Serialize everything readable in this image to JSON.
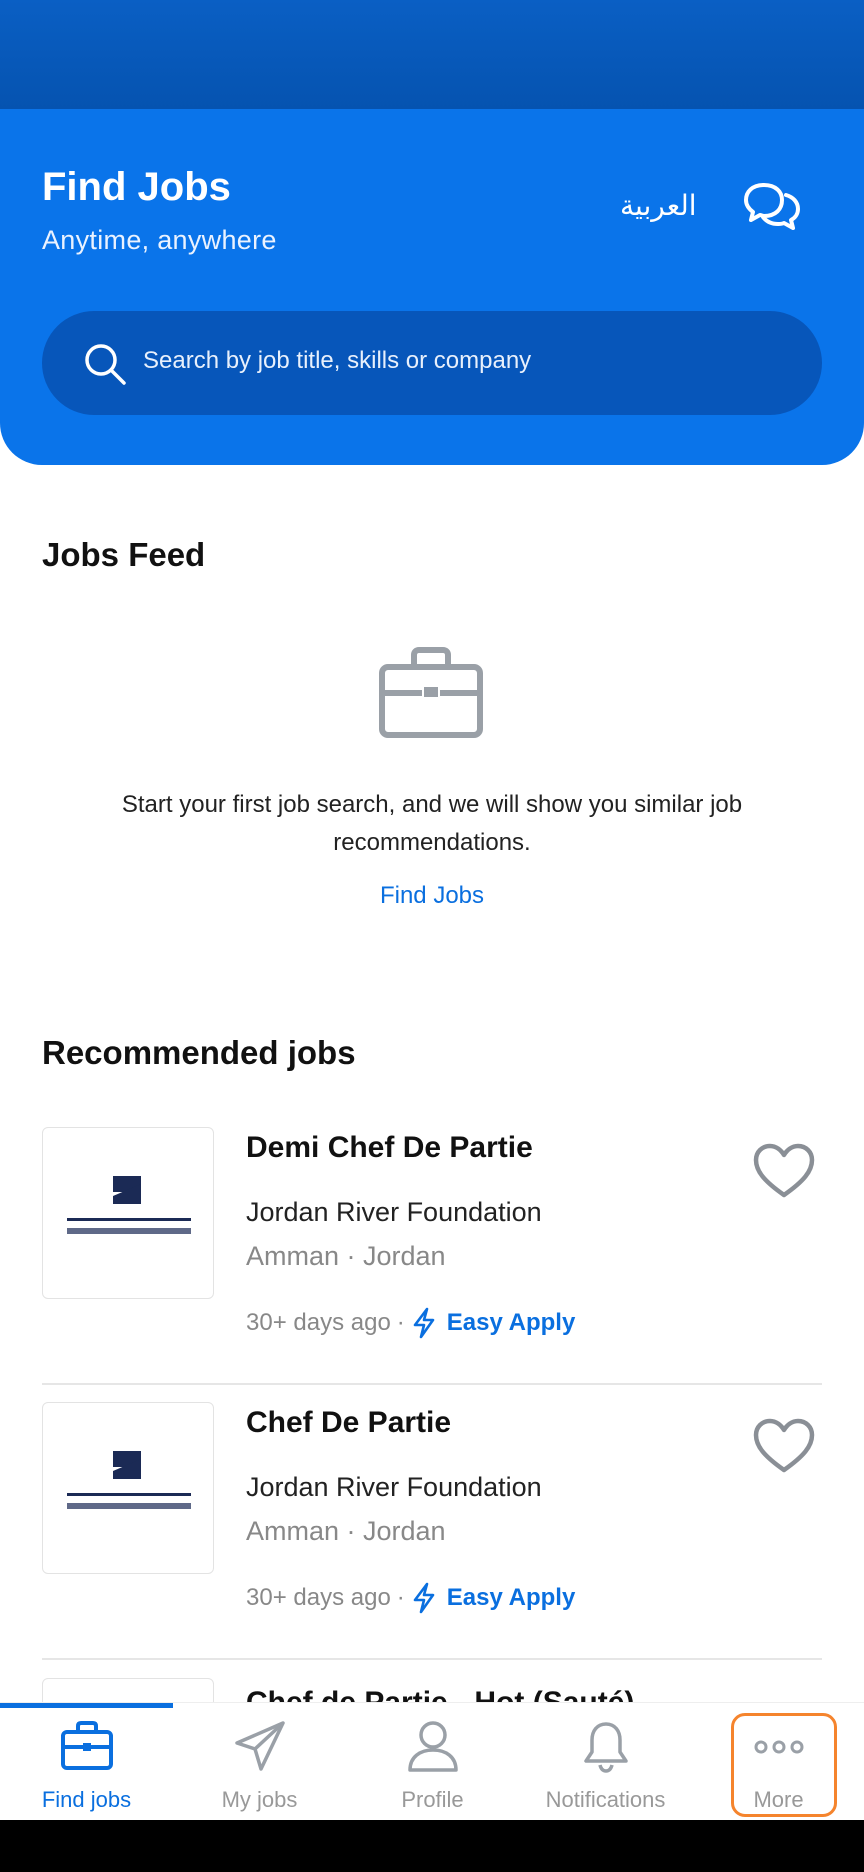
{
  "header": {
    "title": "Find Jobs",
    "subtitle": "Anytime, anywhere",
    "language_label": "العربية",
    "search_placeholder": "Search by job title, skills or company"
  },
  "jobs_feed": {
    "title": "Jobs Feed",
    "message": "Start your first job search, and we will show you similar job recommendations.",
    "link_label": "Find Jobs"
  },
  "recommended": {
    "title": "Recommended jobs",
    "jobs": [
      {
        "title": "Demi Chef De Partie",
        "company": "Jordan River Foundation",
        "location": "Amman · Jordan",
        "posted": "30+ days ago",
        "apply_label": "Easy Apply"
      },
      {
        "title": "Chef De Partie",
        "company": "Jordan River Foundation",
        "location": "Amman · Jordan",
        "posted": "30+ days ago",
        "apply_label": "Easy Apply"
      },
      {
        "title": "Chef de Partie - Hot (Sauté)"
      }
    ]
  },
  "bottom_nav": {
    "items": [
      {
        "label": "Find jobs",
        "icon": "briefcase-icon",
        "active": true
      },
      {
        "label": "My jobs",
        "icon": "paper-plane-icon",
        "active": false
      },
      {
        "label": "Profile",
        "icon": "person-icon",
        "active": false
      },
      {
        "label": "Notifications",
        "icon": "bell-icon",
        "active": false
      },
      {
        "label": "More",
        "icon": "more-dots-icon",
        "active": false
      }
    ]
  },
  "colors": {
    "brand_blue": "#0a74ea",
    "link_blue": "#0a6fdf",
    "highlight_orange": "#f5842d"
  }
}
